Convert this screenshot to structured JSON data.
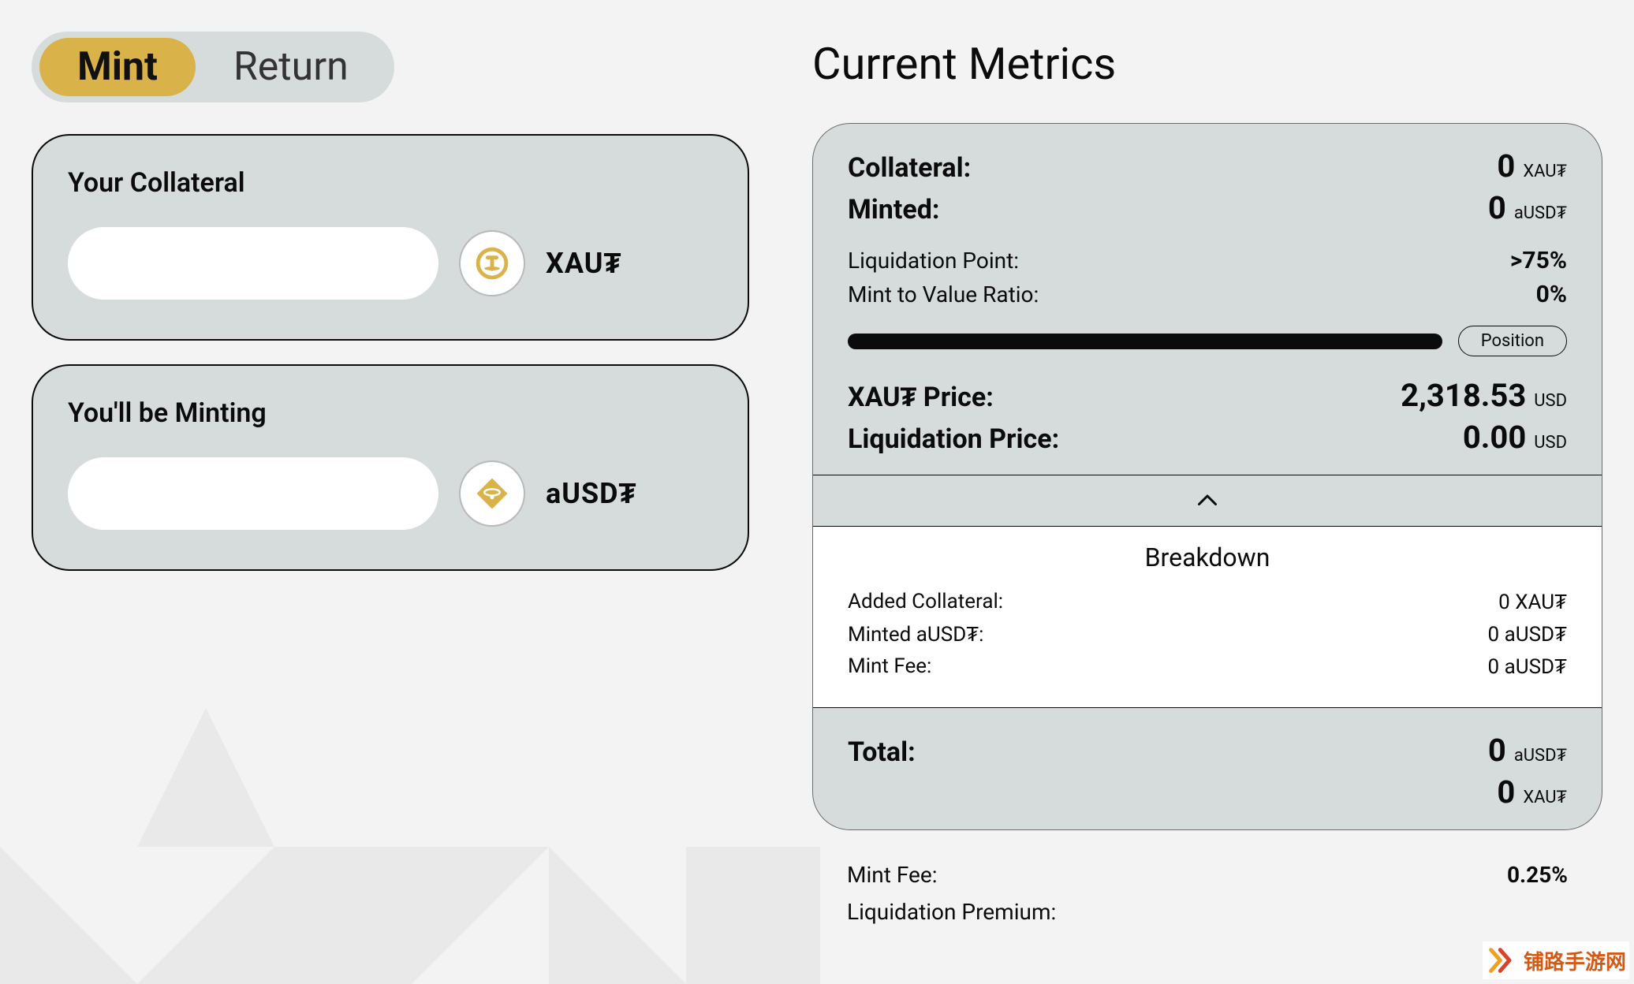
{
  "tabs": {
    "mint": "Mint",
    "return": "Return"
  },
  "form": {
    "collateral": {
      "label": "Your Collateral",
      "symbol": "XAU₮",
      "value": ""
    },
    "minting": {
      "label": "You'll be Minting",
      "symbol": "aUSD₮",
      "value": ""
    }
  },
  "metrics": {
    "title": "Current Metrics",
    "collateral": {
      "label": "Collateral:",
      "value": "0",
      "unit": "XAU₮"
    },
    "minted": {
      "label": "Minted:",
      "value": "0",
      "unit": "aUSD₮"
    },
    "liqPoint": {
      "label": "Liquidation Point:",
      "value": ">75%"
    },
    "mtv": {
      "label": "Mint to Value Ratio:",
      "value": "0%"
    },
    "positionPill": "Position",
    "xautPrice": {
      "label": "XAU₮ Price:",
      "value": "2,318.53",
      "unit": "USD"
    },
    "liqPrice": {
      "label": "Liquidation Price:",
      "value": "0.00",
      "unit": "USD"
    },
    "breakdown": {
      "title": "Breakdown",
      "addedCollateral": {
        "label": "Added Collateral:",
        "value": "0 XAU₮"
      },
      "mintedAusdt": {
        "label": "Minted aUSD₮:",
        "value": "0 aUSD₮"
      },
      "mintFee": {
        "label": "Mint Fee:",
        "value": "0 aUSD₮"
      }
    },
    "total": {
      "label": "Total:",
      "line1": {
        "value": "0",
        "unit": "aUSD₮"
      },
      "line2": {
        "value": "0",
        "unit": "XAU₮"
      }
    }
  },
  "extra": {
    "mintFee": {
      "label": "Mint Fee:",
      "value": "0.25%"
    },
    "liqPremium": {
      "label": "Liquidation Premium:",
      "value": ""
    }
  },
  "watermark": "铺路手游网",
  "colors": {
    "accent": "#d9b24a",
    "panel": "#d6dcdc",
    "text": "#0b0b0b"
  }
}
